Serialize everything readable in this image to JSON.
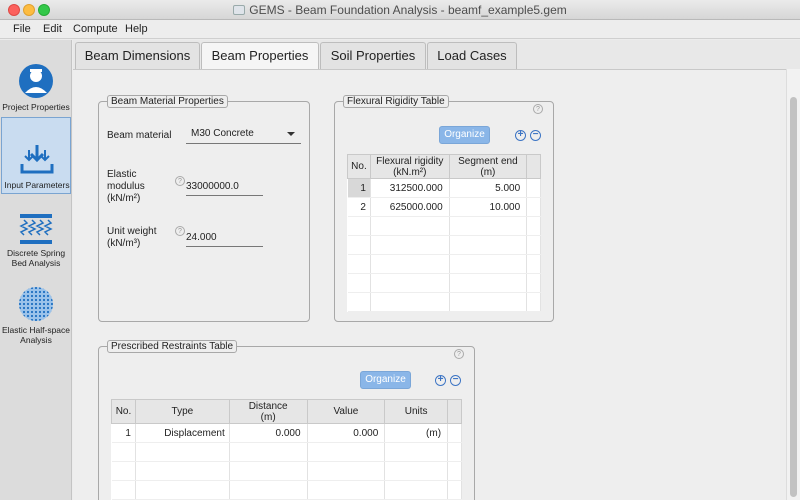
{
  "window": {
    "title": "GEMS - Beam Foundation Analysis - beamf_example5.gem"
  },
  "menu": [
    "File",
    "Edit",
    "Compute",
    "Help"
  ],
  "sidebar": {
    "items": [
      {
        "label_line1": "Project Properties",
        "label_line2": "",
        "icon": "user-icon"
      },
      {
        "label_line1": "Input Parameters",
        "label_line2": "",
        "icon": "input-icon"
      },
      {
        "label_line1": "Discrete Spring",
        "label_line2": "Bed Analysis",
        "icon": "spring-bed-icon"
      },
      {
        "label_line1": "Elastic Half-space",
        "label_line2": "Analysis",
        "icon": "half-space-icon"
      }
    ]
  },
  "tabs": [
    "Beam Dimensions",
    "Beam Properties",
    "Soil Properties",
    "Load Cases"
  ],
  "beam_material": {
    "legend": "Beam Material Properties",
    "material_label": "Beam material",
    "material_value": "M30 Concrete",
    "elastic_label_1": "Elastic",
    "elastic_label_2": "modulus",
    "elastic_label_3": "(kN/m²)",
    "elastic_value": "33000000.0",
    "unit_weight_label_1": "Unit weight",
    "unit_weight_label_2": "(kN/m³)",
    "unit_weight_value": "24.000"
  },
  "flexural": {
    "legend": "Flexural Rigidity Table",
    "organize": "Organize",
    "headers": {
      "no": "No.",
      "rigidity_1": "Flexural rigidity",
      "rigidity_2": "(kN.m²)",
      "segment_1": "Segment end",
      "segment_2": "(m)"
    },
    "rows": [
      {
        "no": "1",
        "rigidity": "312500.000",
        "segment": "5.000"
      },
      {
        "no": "2",
        "rigidity": "625000.000",
        "segment": "10.000"
      }
    ]
  },
  "restraints": {
    "legend": "Prescribed Restraints Table",
    "organize": "Organize",
    "headers": {
      "no": "No.",
      "type": "Type",
      "distance_1": "Distance",
      "distance_2": "(m)",
      "value": "Value",
      "units": "Units"
    },
    "rows": [
      {
        "no": "1",
        "type": "Displacement",
        "distance": "0.000",
        "value": "0.000",
        "units": "(m)"
      }
    ]
  },
  "icons": {
    "help": "?",
    "add": "+",
    "remove": "−"
  }
}
